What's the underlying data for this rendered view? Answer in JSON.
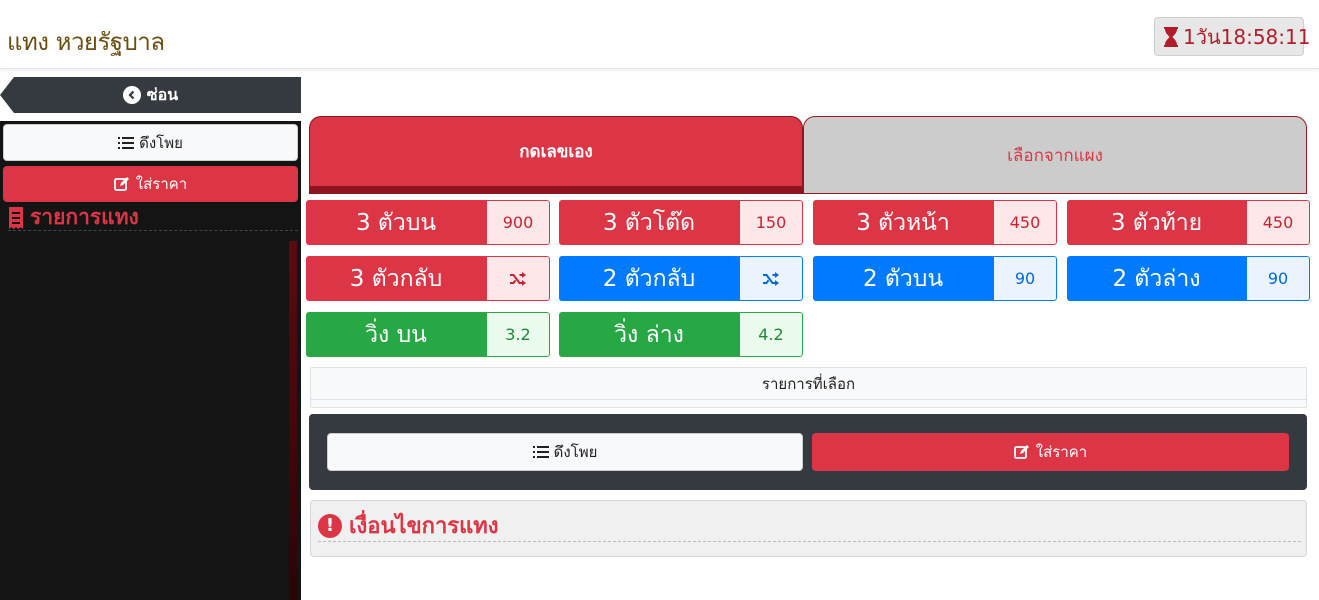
{
  "header": {
    "title": "แทง หวยรัฐบาล",
    "countdown": "1วัน18:58:11"
  },
  "sidebar": {
    "hide_label": "ซ่อน",
    "pull_label": "ดึงโพย",
    "price_label": "ใส่ราคา",
    "list_title": "รายการแทง"
  },
  "tabs": {
    "manual": "กดเลขเอง",
    "from_panel": "เลือกจากแผง"
  },
  "bets": [
    {
      "label": "3 ตัวบน",
      "value": "900"
    },
    {
      "label": "3 ตัวโต๊ด",
      "value": "150"
    },
    {
      "label": "3 ตัวหน้า",
      "value": "450"
    },
    {
      "label": "3 ตัวท้าย",
      "value": "450"
    },
    {
      "label": "3 ตัวกลับ",
      "value": "shuffle-icon"
    },
    {
      "label": "2 ตัวกลับ",
      "value": "shuffle-icon"
    },
    {
      "label": "2 ตัวบน",
      "value": "90"
    },
    {
      "label": "2 ตัวล่าง",
      "value": "90"
    },
    {
      "label": "วิ่ง บน",
      "value": "3.2"
    },
    {
      "label": "วิ่ง ล่าง",
      "value": "4.2"
    }
  ],
  "selected": {
    "title": "รายการที่เลือก"
  },
  "actions": {
    "pull_label": "ดึงโพย",
    "price_label": "ใส่ราคา"
  },
  "conditions": {
    "title": "เงื่อนไขการแทง"
  },
  "colors": {
    "red": "#dc3545",
    "blue": "#007bff",
    "green": "#28a745",
    "dark": "#343a40",
    "title_brown": "#6b4e12"
  }
}
